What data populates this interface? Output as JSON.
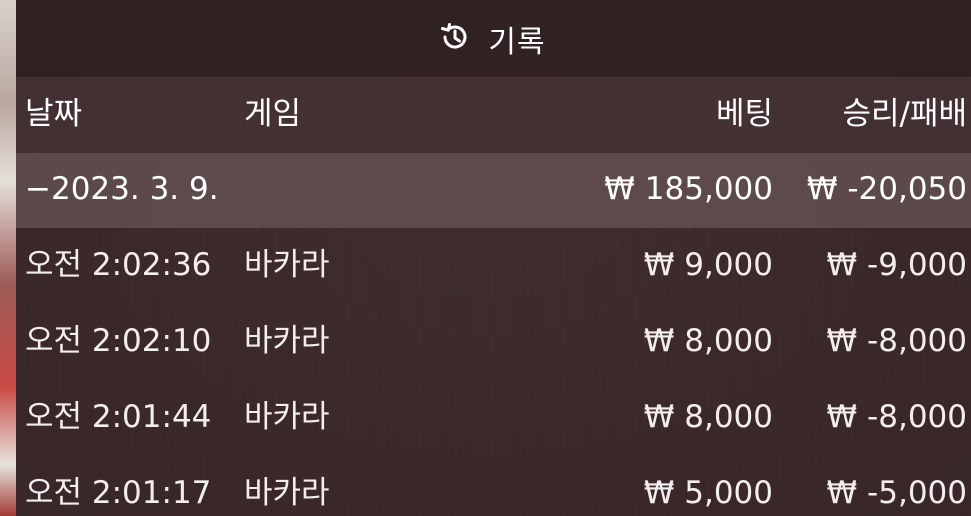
{
  "header": {
    "title": "기록",
    "icon": "history-icon"
  },
  "columns": {
    "date": "날짜",
    "game": "게임",
    "bet": "베팅",
    "result": "승리/패배"
  },
  "date_group": {
    "date": "−2023. 3. 9.",
    "bet_total": "₩ 185,000",
    "result_total": "₩ -20,050"
  },
  "rows": [
    {
      "time": "오전 2:02:36",
      "game": "바카라",
      "bet": "₩ 9,000",
      "result": "₩ -9,000"
    },
    {
      "time": "오전 2:02:10",
      "game": "바카라",
      "bet": "₩ 8,000",
      "result": "₩ -8,000"
    },
    {
      "time": "오전 2:01:44",
      "game": "바카라",
      "bet": "₩ 8,000",
      "result": "₩ -8,000"
    },
    {
      "time": "오전 2:01:17",
      "game": "바카라",
      "bet": "₩ 5,000",
      "result": "₩ -5,000"
    }
  ]
}
